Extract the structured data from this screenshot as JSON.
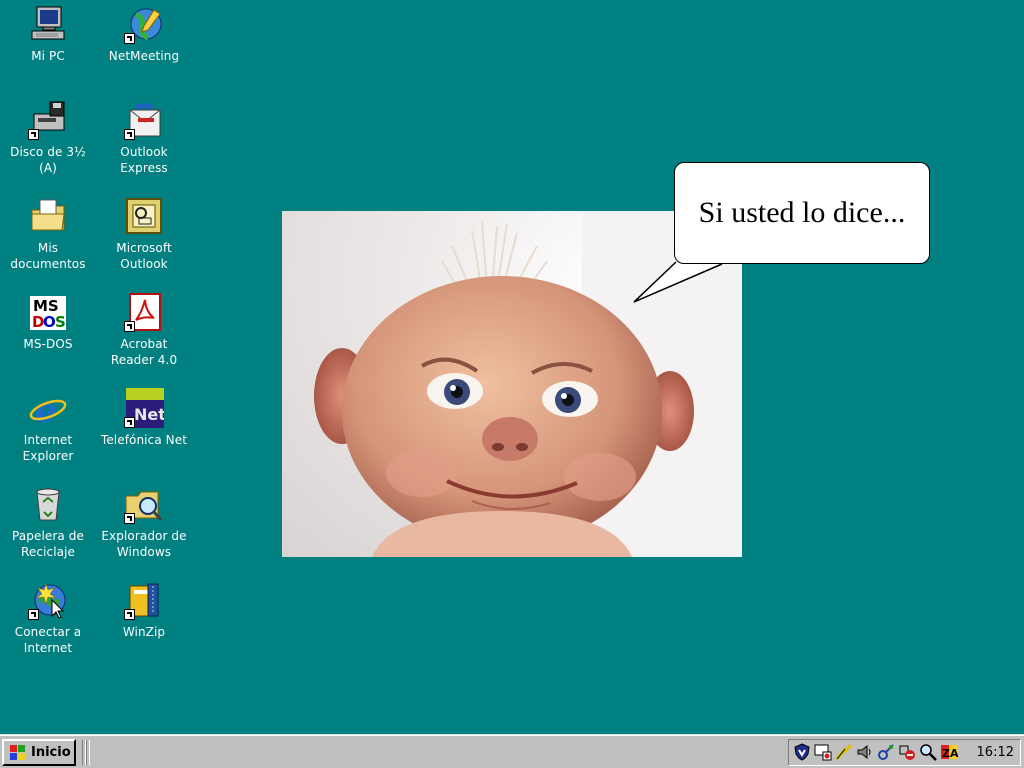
{
  "desktop": {
    "icons": [
      {
        "name": "mi-pc",
        "label": "Mi PC",
        "icon": "computer-icon"
      },
      {
        "name": "netmeeting",
        "label": "NetMeeting",
        "icon": "netmeeting-icon"
      },
      {
        "name": "disco-3-5",
        "label": "Disco de 3½\n(A)",
        "icon": "floppy-drive-icon"
      },
      {
        "name": "outlook-express",
        "label": "Outlook\nExpress",
        "icon": "outlook-express-icon"
      },
      {
        "name": "mis-documentos",
        "label": "Mis\ndocumentos",
        "icon": "documents-folder-icon"
      },
      {
        "name": "microsoft-outlook",
        "label": "Microsoft\nOutlook",
        "icon": "outlook-icon"
      },
      {
        "name": "ms-dos",
        "label": "MS-DOS",
        "icon": "ms-dos-icon"
      },
      {
        "name": "acrobat-reader",
        "label": "Acrobat\nReader 4.0",
        "icon": "acrobat-icon"
      },
      {
        "name": "internet-explorer",
        "label": "Internet\nExplorer",
        "icon": "internet-explorer-icon"
      },
      {
        "name": "telefonica-net",
        "label": "Telefónica Net",
        "icon": "telefonica-net-icon"
      },
      {
        "name": "papelera",
        "label": "Papelera de\nReciclaje",
        "icon": "recycle-bin-icon"
      },
      {
        "name": "explorador-windows",
        "label": "Explorador de\nWindows",
        "icon": "explorer-icon"
      },
      {
        "name": "conectar-internet",
        "label": "Conectar a\nInternet",
        "icon": "connect-internet-icon"
      },
      {
        "name": "winzip",
        "label": "WinZip",
        "icon": "winzip-icon"
      }
    ],
    "telefonica_badge": "Net"
  },
  "bubble": {
    "text": "Si usted lo dice..."
  },
  "taskbar": {
    "start_label": "Inicio",
    "clock": "16:12",
    "tray_icons": [
      "shield-icon",
      "monitor-icon",
      "power-icon",
      "volume-icon",
      "network-icon",
      "antivirus-icon",
      "magnifier-icon",
      "zonealarm-icon"
    ]
  },
  "colors": {
    "desktop": "#008080",
    "taskbar": "#c0c0c0"
  }
}
